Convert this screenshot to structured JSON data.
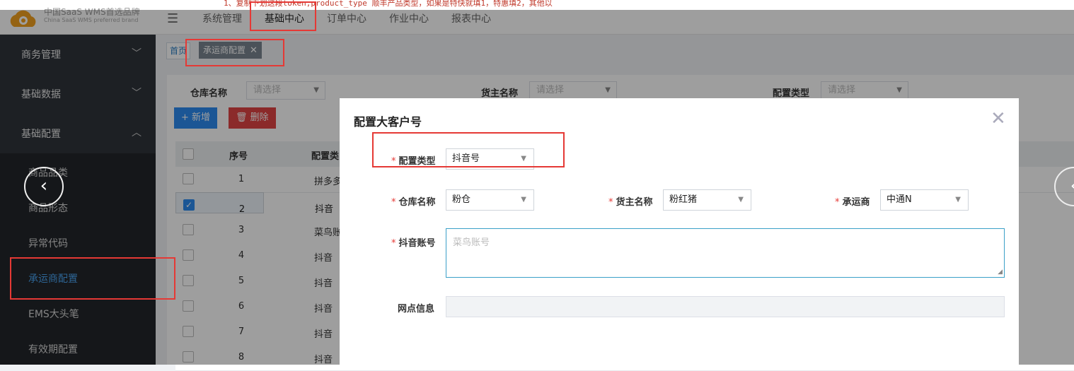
{
  "top_note": "1、复制下划这段token,product_type 顺丰产品类型，如果是特快就填1，特惠填2，其他以",
  "header": {
    "brand": "中国SaaS WMS首选品牌",
    "brand_en": "China SaaS WMS preferred brand",
    "menu": [
      {
        "label": "系统管理"
      },
      {
        "label": "基础中心"
      },
      {
        "label": "订单中心"
      },
      {
        "label": "作业中心"
      },
      {
        "label": "报表中心"
      }
    ],
    "hamburger": "☰"
  },
  "sidebar": {
    "groups": [
      {
        "label": "商务管理",
        "chev": "﹀"
      },
      {
        "label": "基础数据",
        "chev": "﹀"
      },
      {
        "label": "基础配置",
        "chev": "︿"
      }
    ],
    "sub_items": [
      {
        "label": "商品品类"
      },
      {
        "label": "商品形态"
      },
      {
        "label": "异常代码"
      },
      {
        "label": "承运商配置"
      },
      {
        "label": "EMS大头笔"
      },
      {
        "label": "有效期配置"
      }
    ]
  },
  "tabs": {
    "home": "首页",
    "active": "承运商配置",
    "close": "✕"
  },
  "filters": {
    "warehouse_label": "仓库名称",
    "owner_label": "货主名称",
    "type_label": "配置类型",
    "placeholder": "请选择"
  },
  "actions": {
    "add": "+ 新增",
    "delete": "🗑 删除"
  },
  "table": {
    "headers": {
      "no": "序号",
      "type": "配置类"
    },
    "rows": [
      {
        "no": "1",
        "type": "拼多多",
        "checked": false
      },
      {
        "no": "2",
        "type": "抖音",
        "checked": true
      },
      {
        "no": "3",
        "type": "菜鸟账",
        "checked": false
      },
      {
        "no": "4",
        "type": "抖音",
        "checked": false
      },
      {
        "no": "5",
        "type": "抖音",
        "checked": false
      },
      {
        "no": "6",
        "type": "抖音",
        "checked": false
      },
      {
        "no": "7",
        "type": "抖音",
        "checked": false
      },
      {
        "no": "8",
        "type": "抖音",
        "checked": false
      }
    ]
  },
  "modal": {
    "title": "配置大客户号",
    "close": "✕",
    "required_mark": "*",
    "config_type_label": "配置类型",
    "config_type_value": "抖音号",
    "warehouse_label": "仓库名称",
    "warehouse_value": "粉仓",
    "owner_label": "货主名称",
    "owner_value": "粉红猪",
    "carrier_label": "承运商",
    "carrier_value": "中通N",
    "account_label": "抖音账号",
    "account_placeholder": "菜鸟账号",
    "outlet_label": "网点信息"
  },
  "carousel": {
    "prev": "‹",
    "next": "‹"
  }
}
